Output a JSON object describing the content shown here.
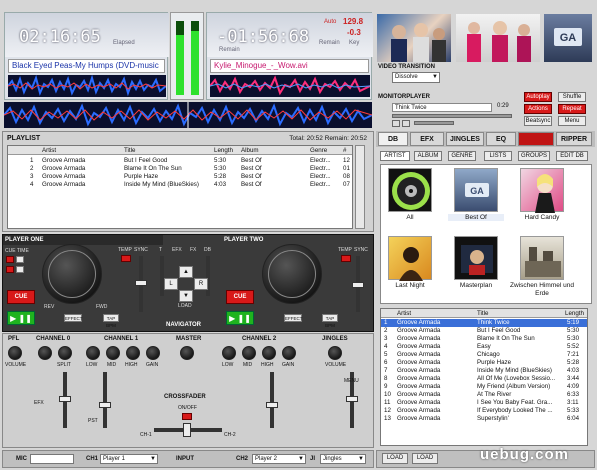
{
  "deck1": {
    "timer": "02:16:65",
    "elapsed": "Elapsed",
    "title": "Black Eyed Peas-My Humps (DVD-music"
  },
  "deck2": {
    "timer": "-01:56:68",
    "remain": "Remain",
    "title": "Kylie_Minogue_-_Wow.avi",
    "auto": "Auto",
    "bpm": "129.8",
    "pitch": "-0.3",
    "remain_label": "Remain",
    "key_label": "Key"
  },
  "video_transition": {
    "label": "VIDEO TRANSITION",
    "value": "Dissolve"
  },
  "monitor": {
    "label": "MONITORPLAYER",
    "track": "Think Twice",
    "time": "0:29",
    "buttons": [
      "Autoplay",
      "Shuffle",
      "Actions",
      "Repeat",
      "Beatsync",
      "Menu"
    ]
  },
  "playlist": {
    "title": "PLAYLIST",
    "summary": "Total: 20:52 Remain: 20:52",
    "columns": [
      "Artist",
      "Title",
      "Length",
      "Album",
      "Genre",
      "#"
    ],
    "rows": [
      [
        "1",
        "Groove Armada",
        "But I Feel Good",
        "5:30",
        "Best Of",
        "Electr...",
        "12"
      ],
      [
        "2",
        "Groove Armada",
        "Blame It On The Sun",
        "5:30",
        "Best Of",
        "Electr...",
        "01"
      ],
      [
        "3",
        "Groove Armada",
        "Purple Haze",
        "5:28",
        "Best Of",
        "Electr...",
        "08"
      ],
      [
        "4",
        "Groove Armada",
        "Inside My Mind (BlueSkies)",
        "4:03",
        "Best Of",
        "Electr...",
        "07"
      ]
    ]
  },
  "players": {
    "one": "PLAYER ONE",
    "two": "PLAYER TWO",
    "cue": "CUE",
    "cue_time": "CUE TIME",
    "temp": "TEMP",
    "sync": "SYNC",
    "rev": "REV",
    "fwd": "FWD",
    "effect": "EFFECT",
    "tap_bpm": "TAP BPM",
    "loop": "Loop",
    "fx_labels": [
      "T",
      "EFX",
      "FX",
      "DB"
    ],
    "load": "LOAD",
    "navigator": "NAVIGATOR",
    "l": "L",
    "r": "R"
  },
  "mixer": {
    "pfl": "PFL",
    "channel0": "CHANNEL 0",
    "channel1": "CHANNEL 1",
    "master": "MASTER",
    "channel2": "CHANNEL 2",
    "jingles": "JINGLES",
    "volume": "VOLUME",
    "split": "SPLIT",
    "low": "LOW",
    "mid": "MID",
    "high": "HIGH",
    "gain": "GAIN",
    "crossfader": "CROSSFADER",
    "onoff": "ON/OFF",
    "ch1": "CH-1",
    "ch2": "CH-2",
    "menu": "MENU",
    "efx": "EFX",
    "pst": "PST"
  },
  "bottom": {
    "mic": "MIC",
    "ch1": "CH1",
    "ch1_value": "Player 1",
    "input": "INPUT",
    "ch2": "CH2",
    "ch2_value": "Player 2",
    "ji": "JI",
    "ji_value": "Jingles"
  },
  "library": {
    "tabs": [
      "DB",
      "EFX",
      "JINGLES",
      "EQ",
      "",
      "RIPPER"
    ],
    "filters": [
      "ARTIST",
      "ALBUM",
      "GENRE",
      "LISTS",
      "GROUPS",
      "EDIT DB"
    ],
    "albums": [
      "All",
      "Best Of",
      "Hard Candy",
      "Last Night",
      "Masterplan",
      "Zwischen Himmel und Erde"
    ],
    "columns": [
      "Artist",
      "Title",
      "Length"
    ],
    "rows": [
      [
        "1",
        "Groove Armada",
        "Think Twice",
        "5:19"
      ],
      [
        "2",
        "Groove Armada",
        "But I Feel Good",
        "5:30"
      ],
      [
        "3",
        "Groove Armada",
        "Blame It On The Sun",
        "5:30"
      ],
      [
        "4",
        "Groove Armada",
        "Easy",
        "5:52"
      ],
      [
        "5",
        "Groove Armada",
        "Chicago",
        "7:21"
      ],
      [
        "6",
        "Groove Armada",
        "Purple Haze",
        "5:28"
      ],
      [
        "7",
        "Groove Armada",
        "Inside My Mind (BlueSkies)",
        "4:03"
      ],
      [
        "8",
        "Groove Armada",
        "All Of Me (Lovebox Sessio...",
        "3:44"
      ],
      [
        "9",
        "Groove Armada",
        "My Friend (Album Version)",
        "4:09"
      ],
      [
        "10",
        "Groove Armada",
        "At The River",
        "6:33"
      ],
      [
        "11",
        "Groove Armada",
        "I See You Baby Feat. Gra...",
        "3:11"
      ],
      [
        "12",
        "Groove Armada",
        "If Everybody Looked The ...",
        "5:33"
      ],
      [
        "13",
        "Groove Armada",
        "Superstylin'",
        "6:04"
      ]
    ],
    "load": "LOAD",
    "watermark": "uebug.com"
  },
  "colors": {
    "accent": "#d81919",
    "green": "#1fb31f",
    "panel": "#c8c8c8"
  }
}
